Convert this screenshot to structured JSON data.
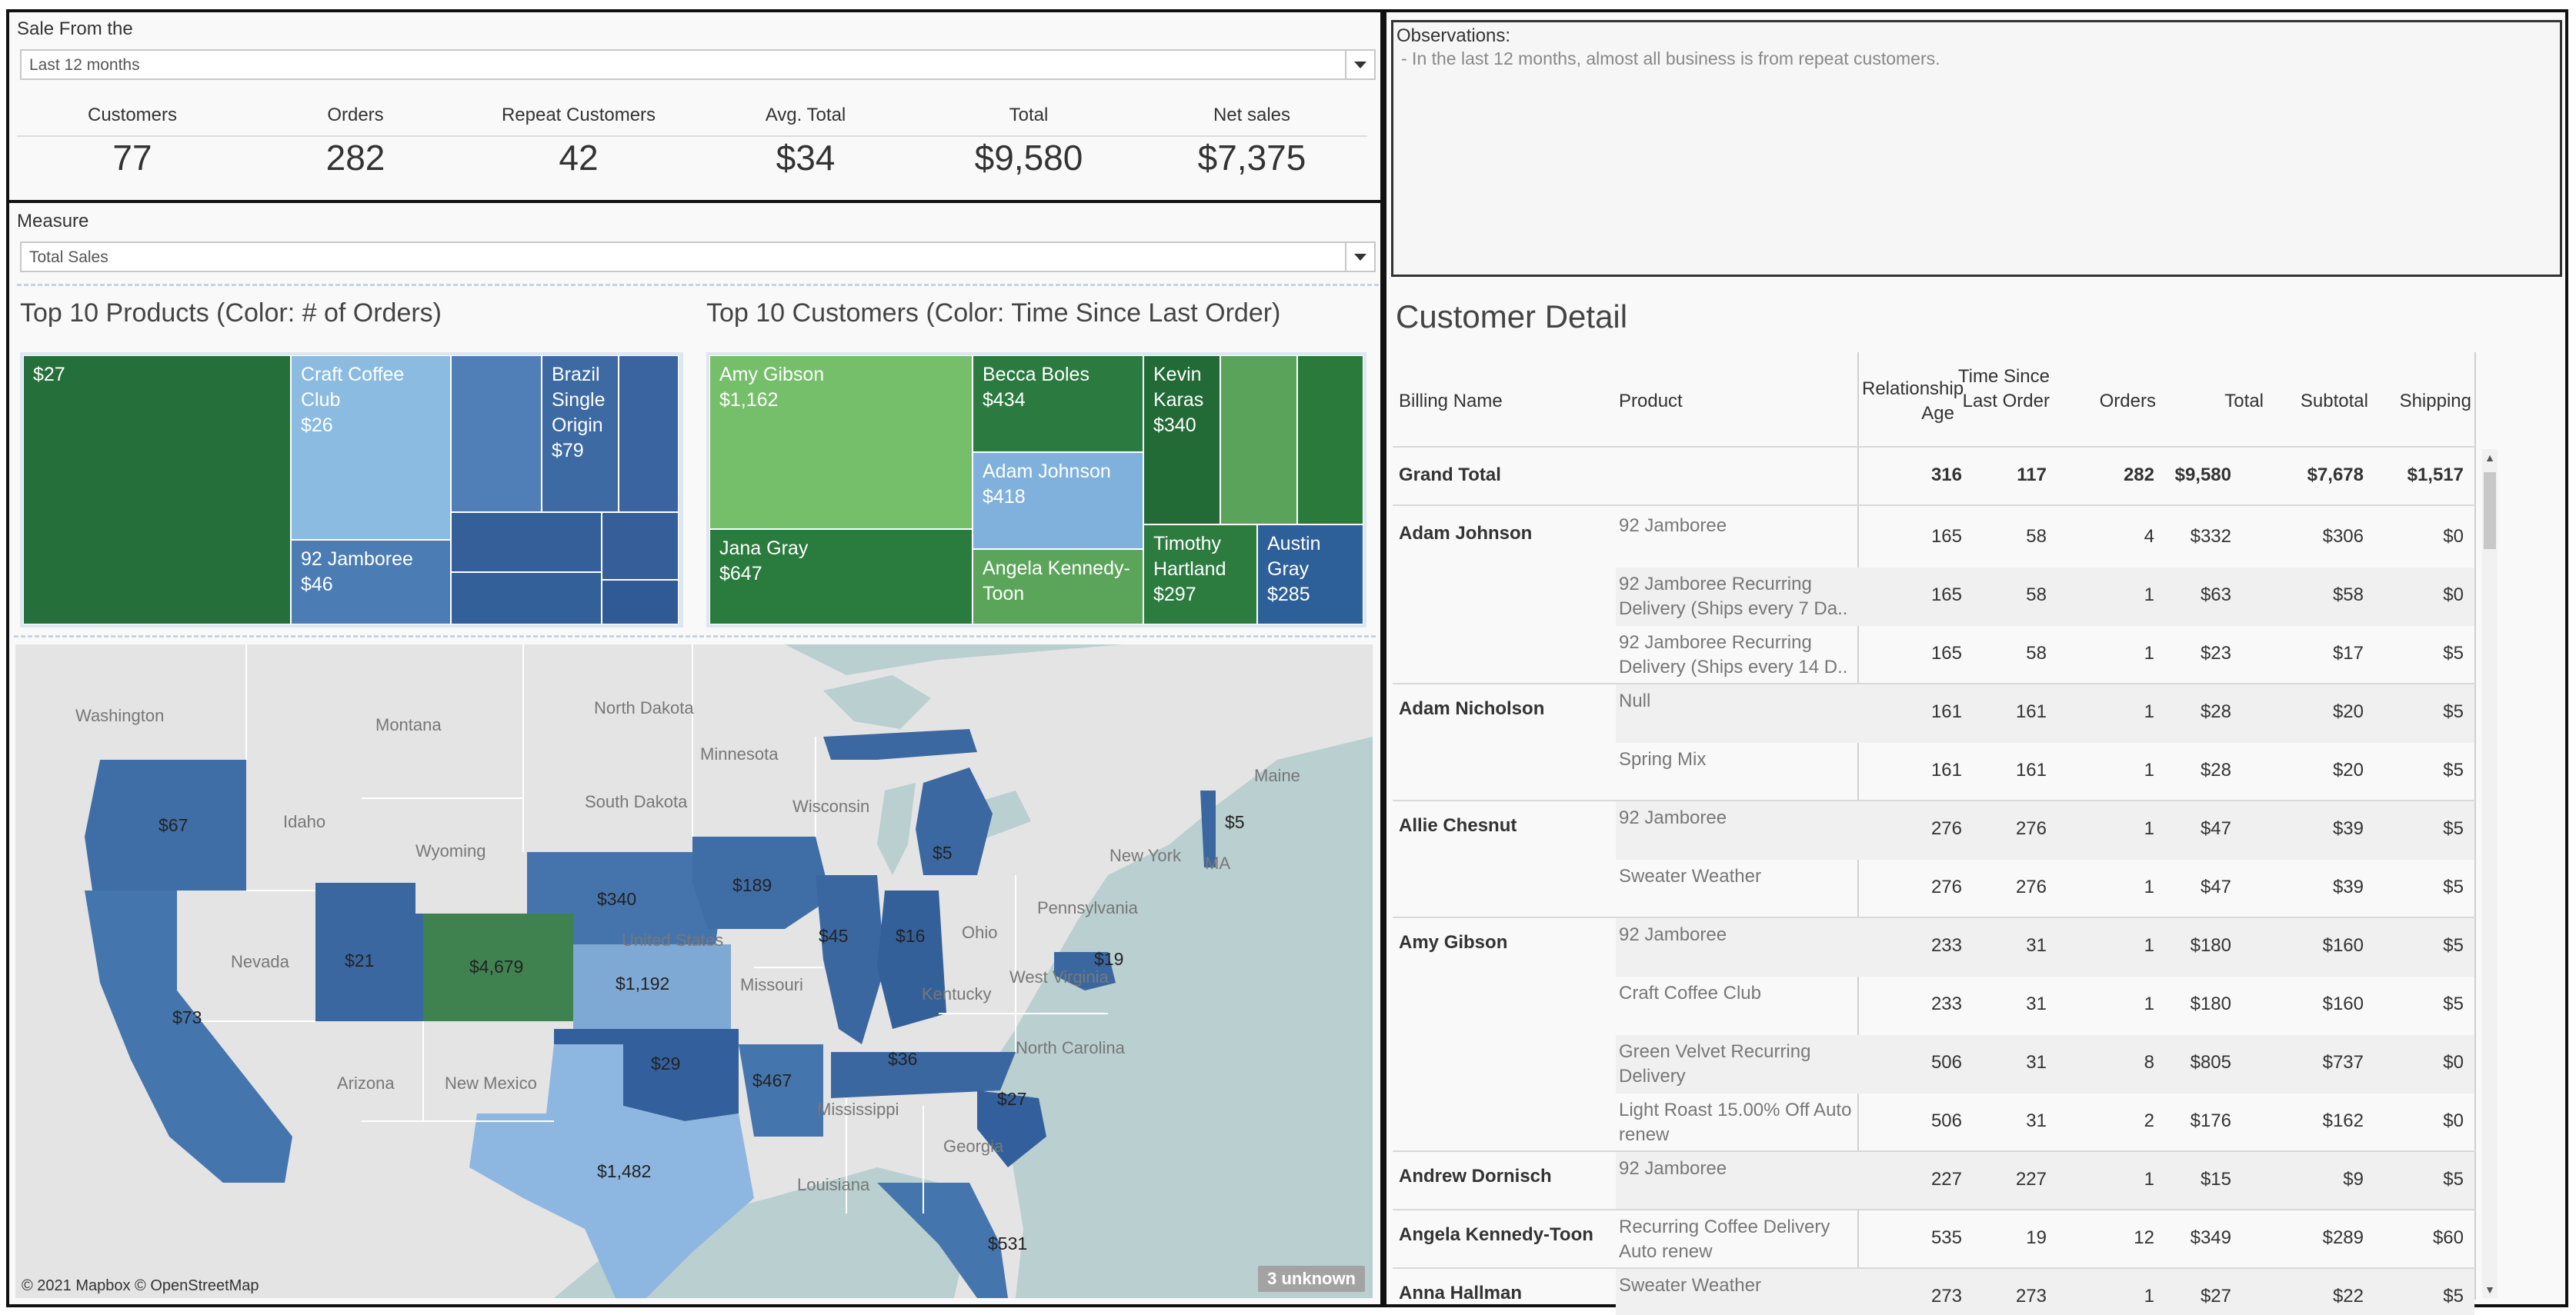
{
  "kpi": {
    "filter_label": "Sale From the",
    "filter_value": "Last 12 months",
    "headers": [
      "Customers",
      "Orders",
      "Repeat Customers",
      "Avg. Total",
      "Total",
      "Net sales"
    ],
    "values": [
      "77",
      "282",
      "42",
      "$34",
      "$9,580",
      "$7,375"
    ]
  },
  "measure": {
    "label": "Measure",
    "value": "Total Sales"
  },
  "observations": {
    "title": "Observations:",
    "text": "- In the last 12 months, almost all business is from repeat customers."
  },
  "products": {
    "title": "Top 10 Products (Color: # of Orders)",
    "tiles": [
      {
        "label": "$27",
        "color": "#25703a"
      },
      {
        "label": "Craft Coffee Club\n$26",
        "color": "#8bbbe0"
      },
      {
        "label": "",
        "color": "#4f7fb6"
      },
      {
        "label": "Brazil Single Origin\n$79",
        "color": "#3d6aa3"
      },
      {
        "label": "",
        "color": "#3a64a0"
      },
      {
        "label": "92 Jamboree\n$46",
        "color": "#4c7cb4"
      },
      {
        "label": "",
        "color": "#355f98"
      },
      {
        "label": "",
        "color": "#365f99"
      },
      {
        "label": "",
        "color": "#34609a"
      },
      {
        "label": "",
        "color": "#2f5a95"
      }
    ]
  },
  "customers": {
    "title": "Top 10 Customers (Color: Time Since Last Order)",
    "tiles": [
      {
        "label": "Amy Gibson\n$1,162",
        "color": "#76bf6a"
      },
      {
        "label": "Becca Boles\n$434",
        "color": "#2b7a3f"
      },
      {
        "label": "Kevin Karas\n$340",
        "color": "#226b36"
      },
      {
        "label": "",
        "color": "#59a35a"
      },
      {
        "label": "",
        "color": "#2a7a3c"
      },
      {
        "label": "Adam Johnson\n$418",
        "color": "#7fb1dc"
      },
      {
        "label": "Jana Gray\n$647",
        "color": "#2a7b3e"
      },
      {
        "label": "Angela Kennedy-Toon",
        "color": "#5aa55a"
      },
      {
        "label": "Timothy Hartland\n$297",
        "color": "#2c7c3f"
      },
      {
        "label": "Austin Gray\n$285",
        "color": "#2d5f98"
      }
    ]
  },
  "map": {
    "state_labels": [
      "Washington",
      "Montana",
      "North Dakota",
      "Minnesota",
      "South Dakota",
      "Wisconsin",
      "Idaho",
      "Wyoming",
      "Nevada",
      "United States",
      "Missouri",
      "Arizona",
      "New Mexico",
      "Pennsylvania",
      "Ohio",
      "West Virginia",
      "Kentucky",
      "North Carolina",
      "Mississippi",
      "Georgia",
      "Louisiana",
      "Maine",
      "New York",
      "MA"
    ],
    "values": [
      "$67",
      "$73",
      "$21",
      "$4,679",
      "$340",
      "$1,192",
      "$189",
      "$45",
      "$16",
      "$5",
      "$5",
      "$19",
      "$29",
      "$467",
      "$36",
      "$27",
      "$1,482",
      "$531"
    ],
    "attribution": "© 2021 Mapbox © OpenStreetMap",
    "unknown": "3 unknown"
  },
  "table": {
    "title": "Customer Detail",
    "headers": [
      "Billing Name",
      "Product",
      "Relationship Age",
      "Time Since Last Order",
      "Orders",
      "Total",
      "Subtotal",
      "Shipping"
    ],
    "grand_total": [
      "Grand Total",
      "",
      "316",
      "117",
      "282",
      "$9,580",
      "$7,678",
      "$1,517"
    ],
    "rows": [
      [
        "Adam Johnson",
        "92 Jamboree",
        "165",
        "58",
        "4",
        "$332",
        "$306",
        "$0"
      ],
      [
        "",
        "92 Jamboree Recurring Delivery (Ships every 7 Da..",
        "165",
        "58",
        "1",
        "$63",
        "$58",
        "$0"
      ],
      [
        "",
        "92 Jamboree Recurring Delivery (Ships every 14 D..",
        "165",
        "58",
        "1",
        "$23",
        "$17",
        "$5"
      ],
      [
        "Adam Nicholson",
        "Null",
        "161",
        "161",
        "1",
        "$28",
        "$20",
        "$5"
      ],
      [
        "",
        "Spring Mix",
        "161",
        "161",
        "1",
        "$28",
        "$20",
        "$5"
      ],
      [
        "Allie Chesnut",
        "92 Jamboree",
        "276",
        "276",
        "1",
        "$47",
        "$39",
        "$5"
      ],
      [
        "",
        "Sweater Weather",
        "276",
        "276",
        "1",
        "$47",
        "$39",
        "$5"
      ],
      [
        "Amy Gibson",
        "92 Jamboree",
        "233",
        "31",
        "1",
        "$180",
        "$160",
        "$5"
      ],
      [
        "",
        "Craft Coffee Club",
        "233",
        "31",
        "1",
        "$180",
        "$160",
        "$5"
      ],
      [
        "",
        "Green Velvet Recurring Delivery",
        "506",
        "31",
        "8",
        "$805",
        "$737",
        "$0"
      ],
      [
        "",
        "Light Roast 15.00% Off Auto renew",
        "506",
        "31",
        "2",
        "$176",
        "$162",
        "$0"
      ],
      [
        "Andrew Dornisch",
        "92 Jamboree",
        "227",
        "227",
        "1",
        "$15",
        "$9",
        "$5"
      ],
      [
        "Angela Kennedy-Toon",
        "Recurring Coffee Delivery Auto renew",
        "535",
        "19",
        "12",
        "$349",
        "$289",
        "$60"
      ],
      [
        "Anna Hallman",
        "Sweater Weather",
        "273",
        "273",
        "1",
        "$27",
        "$22",
        "$5"
      ]
    ]
  }
}
